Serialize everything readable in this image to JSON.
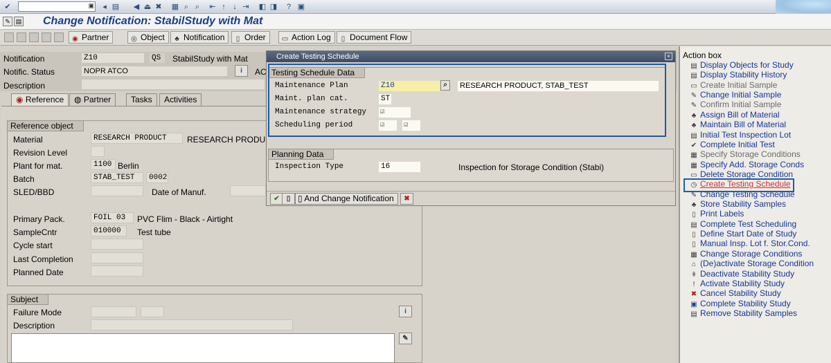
{
  "window": {
    "title": "Change Notification: StabilStudy with Mat"
  },
  "toolbar": [
    {
      "label": "Partner",
      "icon": "partner-icon"
    },
    {
      "label": "Object",
      "icon": "object-icon"
    },
    {
      "label": "Notification",
      "icon": "notification-icon"
    },
    {
      "label": "Order",
      "icon": "order-icon"
    },
    {
      "label": "Action Log",
      "icon": "action-log-icon"
    },
    {
      "label": "Document Flow",
      "icon": "document-flow-icon"
    }
  ],
  "header": {
    "notification_label": "Notification",
    "notification_value": "Z10",
    "notification_type": "QS",
    "notification_desc": "StabilStudy with Mat",
    "status_label": "Notific. Status",
    "status_value": "NOPR ATCO",
    "status_short": "AC",
    "description_label": "Description"
  },
  "tabs": [
    {
      "label": "Reference",
      "active": true
    },
    {
      "label": "Partner",
      "active": false
    },
    {
      "label": "Tasks",
      "active": false
    },
    {
      "label": "Activities",
      "active": false
    }
  ],
  "reference_object": {
    "title": "Reference object",
    "material_label": "Material",
    "material_value": "RESEARCH PRODUCT",
    "material_desc": "RESEARCH PRODUCT",
    "revision_label": "Revision Level",
    "plant_label": "Plant for mat.",
    "plant_value": "1100",
    "plant_desc": "Berlin",
    "batch_label": "Batch",
    "batch_value": "STAB_TEST",
    "batch_extra": "0002",
    "sled_label": "SLED/BBD",
    "manuf_label": "Date of Manuf.",
    "primary_pack_label": "Primary Pack.",
    "primary_pack_value": "FOIL 03",
    "primary_pack_desc": "PVC Flim - Black - Airtight",
    "samplecntr_label": "SampleCntr",
    "samplecntr_value": "010000",
    "samplecntr_desc": "Test tube",
    "cycle_start_label": "Cycle start",
    "last_completion_label": "Last Completion",
    "planned_date_label": "Planned Date"
  },
  "subject": {
    "title": "Subject",
    "failure_mode_label": "Failure Mode",
    "description_label": "Description"
  },
  "dialog": {
    "title": "Create Testing Schedule",
    "group1_title": "Testing Schedule Data",
    "maint_plan_label": "Maintenance Plan",
    "maint_plan_value": "Z10",
    "maint_plan_desc": "RESEARCH PRODUCT, STAB_TEST",
    "maint_plan_cat_label": "Maint. plan cat.",
    "maint_plan_cat_value": "ST",
    "maint_strategy_label": "Maintenance strategy",
    "sched_period_label": "Scheduling period",
    "group2_title": "Planning Data",
    "insp_type_label": "Inspection Type",
    "insp_type_value": "16",
    "insp_type_desc": "Inspection for Storage Condition (Stabi)",
    "change_notification_label": "And Change Notification"
  },
  "action_box": {
    "title": "Action box",
    "items": [
      {
        "label": "Display Objects for Study",
        "enabled": true,
        "icon": "display-icon"
      },
      {
        "label": "Display Stability History",
        "enabled": true,
        "icon": "history-icon"
      },
      {
        "label": "Create Initial Sample",
        "enabled": false,
        "icon": "sample-icon"
      },
      {
        "label": "Change Initial Sample",
        "enabled": true,
        "icon": "pencil-icon"
      },
      {
        "label": "Confirm Initial Sample",
        "enabled": false,
        "icon": "confirm-icon"
      },
      {
        "label": "Assign Bill of Material",
        "enabled": true,
        "icon": "bom-icon"
      },
      {
        "label": "Maintain Bill of Material",
        "enabled": true,
        "icon": "bom-icon"
      },
      {
        "label": "Initial Test Inspection Lot",
        "enabled": true,
        "icon": "inspection-lot-icon"
      },
      {
        "label": "Complete Initial Test",
        "enabled": true,
        "icon": "complete-icon"
      },
      {
        "label": "Specify Storage Conditions",
        "enabled": false,
        "icon": "storage-icon"
      },
      {
        "label": "Specify Add. Storage Conds",
        "enabled": true,
        "icon": "storage-icon"
      },
      {
        "label": "Delete Storage Condition",
        "enabled": true,
        "icon": "delete-icon"
      },
      {
        "label": "Create Testing Schedule",
        "enabled": true,
        "icon": "clock-icon",
        "selected": true
      },
      {
        "label": "Change Testing Schedule",
        "enabled": true,
        "icon": "pencil-icon"
      },
      {
        "label": "Store Stability Samples",
        "enabled": true,
        "icon": "store-icon"
      },
      {
        "label": "Print Labels",
        "enabled": true,
        "icon": "print-icon"
      },
      {
        "label": "Complete Test Scheduling",
        "enabled": true,
        "icon": "schedule-icon"
      },
      {
        "label": "Define Start Date of Study",
        "enabled": true,
        "icon": "calendar-icon"
      },
      {
        "label": "Manual Insp. Lot f. Stor.Cond.",
        "enabled": true,
        "icon": "document-icon"
      },
      {
        "label": "Change Storage Conditions",
        "enabled": true,
        "icon": "storage-icon"
      },
      {
        "label": "(De)activate Storage Condition",
        "enabled": true,
        "icon": "lock-icon"
      },
      {
        "label": "Deactivate Stability Study",
        "enabled": true,
        "icon": "deactivate-icon"
      },
      {
        "label": "Activate Stability Study",
        "enabled": true,
        "icon": "activate-icon"
      },
      {
        "label": "Cancel Stability Study",
        "enabled": true,
        "icon": "cancel-icon"
      },
      {
        "label": "Complete Stability Study",
        "enabled": true,
        "icon": "complete-study-icon"
      },
      {
        "label": "Remove Stability Samples",
        "enabled": true,
        "icon": "remove-icon"
      }
    ]
  },
  "colors": {
    "title_blue": "#1c3e87",
    "link_blue": "#14369b",
    "highlight_border": "#1c5ea8",
    "dialog_title_bg": "#3e4c63"
  }
}
